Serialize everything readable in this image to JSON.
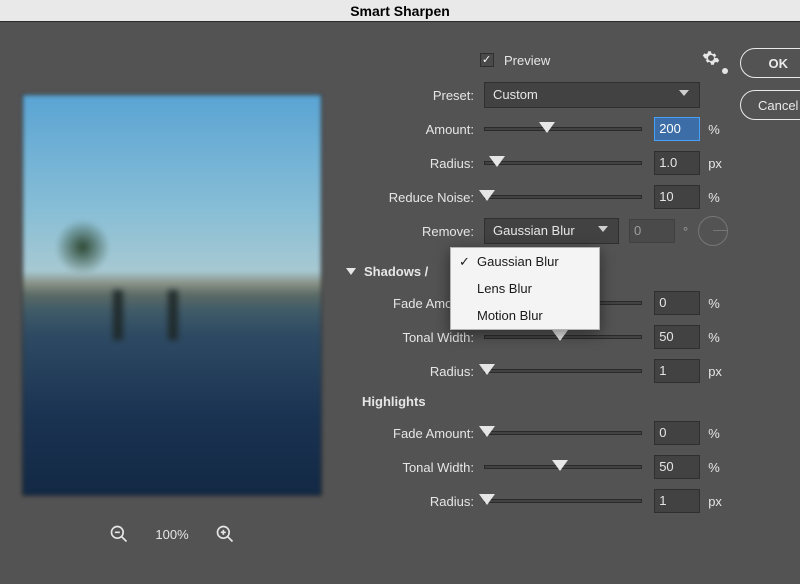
{
  "title": "Smart Sharpen",
  "preview_label": "Preview",
  "preview_checked": true,
  "preset_label": "Preset:",
  "preset_value": "Custom",
  "buttons": {
    "ok": "OK",
    "cancel": "Cancel"
  },
  "main": {
    "amount": {
      "label": "Amount:",
      "value": "200",
      "unit": "%",
      "pos": 40
    },
    "radius": {
      "label": "Radius:",
      "value": "1.0",
      "unit": "px",
      "pos": 8
    },
    "reduce_noise": {
      "label": "Reduce Noise:",
      "value": "10",
      "unit": "%",
      "pos": 1
    },
    "remove": {
      "label": "Remove:",
      "value": "Gaussian Blur",
      "angle": "0",
      "angle_unit": "°"
    }
  },
  "dropdown": {
    "items": [
      "Gaussian Blur",
      "Lens Blur",
      "Motion Blur"
    ],
    "checked_index": 0
  },
  "section_label": "Shadows /",
  "shadows": {
    "fade": {
      "label": "Fade Amount:",
      "value": "0",
      "unit": "%",
      "pos": 1
    },
    "tonal": {
      "label": "Tonal Width:",
      "value": "50",
      "unit": "%",
      "pos": 48
    },
    "radius": {
      "label": "Radius:",
      "value": "1",
      "unit": "px",
      "pos": 1
    }
  },
  "highlights_label": "Highlights",
  "highlights": {
    "fade": {
      "label": "Fade Amount:",
      "value": "0",
      "unit": "%",
      "pos": 1
    },
    "tonal": {
      "label": "Tonal Width:",
      "value": "50",
      "unit": "%",
      "pos": 48
    },
    "radius": {
      "label": "Radius:",
      "value": "1",
      "unit": "px",
      "pos": 1
    }
  },
  "zoom_pct": "100%"
}
